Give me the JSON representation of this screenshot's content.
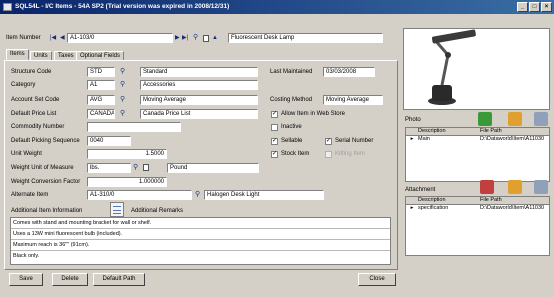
{
  "window": {
    "title": "SQL54L - I/C Items - 54A SP2 (Trial version was expired in 2008/12/31)",
    "min": "_",
    "max": "□",
    "close": "×"
  },
  "header": {
    "item_number_label": "Item Number",
    "item_number": "A1-103/0",
    "description": "Fluorescent Desk Lamp"
  },
  "tabs": [
    "Items",
    "Units",
    "Taxes",
    "Optional Fields"
  ],
  "form": {
    "structure_code": {
      "label": "Structure Code",
      "value": "STD",
      "desc": "Standard"
    },
    "category": {
      "label": "Category",
      "value": "A1",
      "desc": "Accessories"
    },
    "account_set": {
      "label": "Account Set Code",
      "value": "AVG",
      "desc": "Moving Average"
    },
    "price_list": {
      "label": "Default Price List",
      "value": "CANADA",
      "desc": "Canada Price List"
    },
    "commodity": {
      "label": "Commodity Number",
      "value": ""
    },
    "picking_seq": {
      "label": "Default Picking Sequence",
      "value": "0040"
    },
    "unit_weight": {
      "label": "Unit Weight",
      "value": "1.5000"
    },
    "weight_uom": {
      "label": "Weight Unit of Measure",
      "value": "lbs.",
      "desc": "Pound"
    },
    "weight_factor": {
      "label": "Weight Conversion Factor",
      "value": "1.000000"
    },
    "alternate": {
      "label": "Alternate Item",
      "value": "A1-310/0",
      "desc": "Halogen Desk Light"
    },
    "last_maintained_label": "Last Maintained",
    "last_maintained": "03/03/2008",
    "costing_label": "Costing Method",
    "costing": "Moving Average",
    "checks": {
      "allow_web": "Allow Item in Web Store",
      "inactive": "Inactive",
      "sellable": "Sellable",
      "serial": "Serial Number",
      "stock": "Stock Item",
      "kitting": "Kitting Item"
    },
    "add_info_label": "Additional Item Information",
    "add_remarks_label": "Additional Remarks",
    "remarks": [
      "Comes with stand and mounting bracket for wall or shelf.",
      "Uses a 13W mini fluorescent bulb (included).",
      "Maximum reach is 36\"\" (91cm).",
      "Black only."
    ]
  },
  "buttons": {
    "save": "Save",
    "delete": "Delete",
    "default_path": "Default Path",
    "close": "Close"
  },
  "photo": {
    "label": "Photo",
    "col1": "Description",
    "col2": "File Path",
    "rows": [
      {
        "desc": "Main",
        "path": "D:\\Dataworld\\Item\\A11030"
      }
    ]
  },
  "attachment": {
    "label": "Attachment",
    "col1": "Description",
    "col2": "File Path",
    "rows": [
      {
        "desc": "specification",
        "path": "D:\\Dataworld\\Item\\A11030"
      }
    ]
  }
}
